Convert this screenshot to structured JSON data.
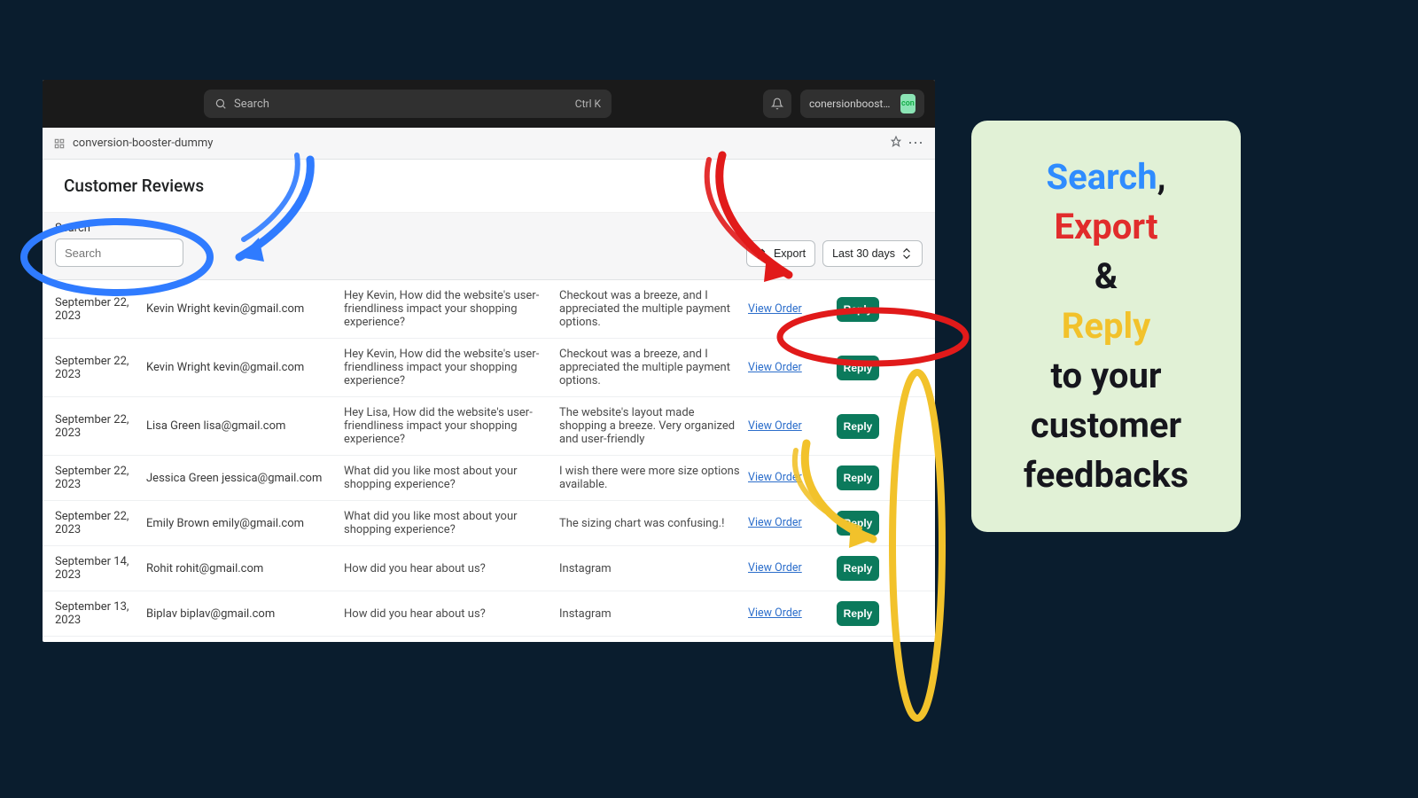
{
  "topbar": {
    "search_placeholder": "Search",
    "kbd": "Ctrl K",
    "store_name": "conersionbooster-che…",
    "avatar_label": "con"
  },
  "breadcrumb": "conversion-booster-dummy",
  "page_title": "Customer Reviews",
  "filters": {
    "search_label": "Search",
    "search_placeholder": "Search",
    "export_label": "Export",
    "range_label": "Last 30 days"
  },
  "row_actions": {
    "view_order": "View Order",
    "reply": "Reply"
  },
  "rows": [
    {
      "date": "September 22, 2023",
      "customer": "Kevin Wright kevin@gmail.com",
      "question": "Hey Kevin, How did the website's user-friendliness impact your shopping experience?",
      "answer": "Checkout was a breeze, and I appreciated the multiple payment options."
    },
    {
      "date": "September 22, 2023",
      "customer": "Kevin Wright kevin@gmail.com",
      "question": "Hey Kevin, How did the website's user-friendliness impact your shopping experience?",
      "answer": "Checkout was a breeze, and I appreciated the multiple payment options."
    },
    {
      "date": "September 22, 2023",
      "customer": "Lisa Green lisa@gmail.com",
      "question": "Hey Lisa, How did the website's user-friendliness impact your shopping experience?",
      "answer": "The website's layout made shopping a breeze. Very organized and user-friendly"
    },
    {
      "date": "September 22, 2023",
      "customer": "Jessica Green jessica@gmail.com",
      "question": "What did you like most about your shopping experience?",
      "answer": "I wish there were more size options available."
    },
    {
      "date": "September 22, 2023",
      "customer": "Emily Brown emily@gmail.com",
      "question": "What did you like most about your shopping experience?",
      "answer": "The sizing chart was confusing.!"
    },
    {
      "date": "September 14, 2023",
      "customer": "Rohit rohit@gmail.com",
      "question": "How did you hear about us?",
      "answer": "Instagram"
    },
    {
      "date": "September 13, 2023",
      "customer": "Biplav biplav@gmail.com",
      "question": "How did you hear about us?",
      "answer": "Instagram"
    }
  ],
  "callout": {
    "w1": "Search",
    "w2": "Export",
    "amp": "&",
    "w3": "Reply",
    "rest1": "to your",
    "rest2": "customer",
    "rest3": "feedbacks",
    "comma": ","
  }
}
